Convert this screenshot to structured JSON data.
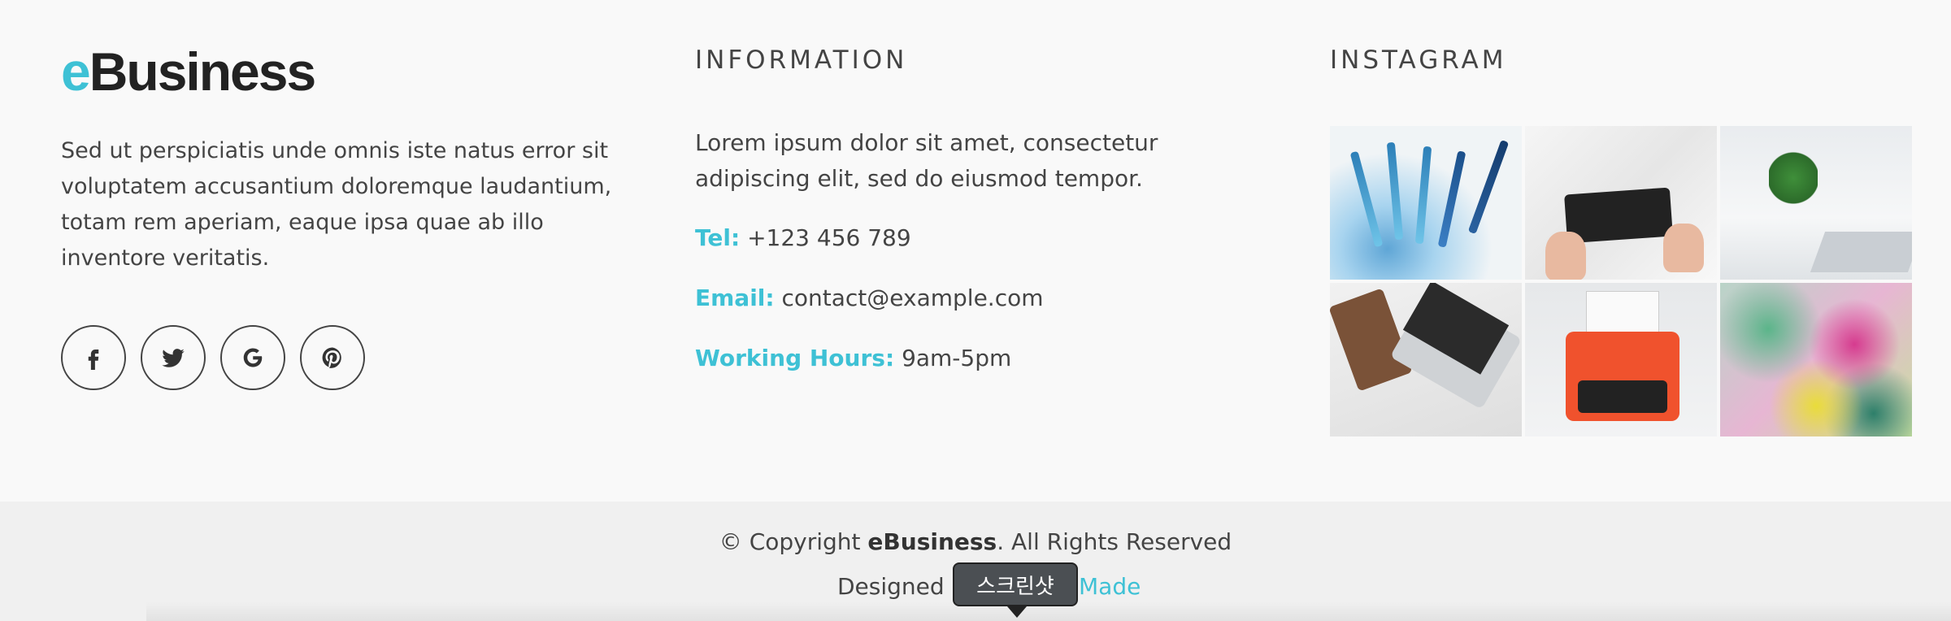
{
  "brand": {
    "logo_accent": "e",
    "logo_rest": "Business",
    "accent_color": "#3ec1d5"
  },
  "about": {
    "text": "Sed ut perspiciatis unde omnis iste natus error sit voluptatem accusantium doloremque laudantium, totam rem aperiam, eaque ipsa quae ab illo inventore veritatis."
  },
  "social": [
    {
      "icon": "facebook-icon"
    },
    {
      "icon": "twitter-icon"
    },
    {
      "icon": "google-icon"
    },
    {
      "icon": "pinterest-icon"
    }
  ],
  "information": {
    "title": "INFORMATION",
    "text": "Lorem ipsum dolor sit amet, consectetur adipiscing elit, sed do eiusmod tempor.",
    "tel_label": "Tel:",
    "tel_value": "+123 456 789",
    "email_label": "Email:",
    "email_value": "contact@example.com",
    "hours_label": "Working Hours:",
    "hours_value": "9am-5pm"
  },
  "instagram": {
    "title": "INSTAGRAM"
  },
  "footer": {
    "copyright_pre": "© Copyright ",
    "copyright_brand": "eBusiness",
    "copyright_post": ". All Rights Reserved",
    "designed_pre": "Designed b",
    "designed_link": "Made"
  },
  "tooltip": {
    "text": "스크린샷"
  }
}
